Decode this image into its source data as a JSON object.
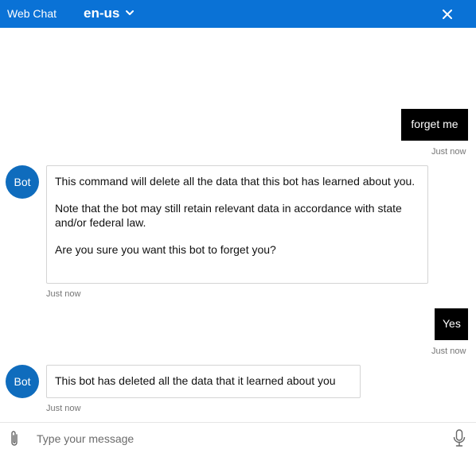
{
  "header": {
    "title": "Web Chat",
    "locale": "en-us",
    "bg_color": "#0a72d6"
  },
  "messages": [
    {
      "from": "user",
      "text": "forget me",
      "timestamp": "Just now"
    },
    {
      "from": "bot",
      "avatar_initials": "Bot",
      "paragraphs": [
        "This command will delete all the data that this bot has learned about you.",
        "Note that the bot may still retain relevant data in accordance with state and/or federal law.",
        "Are you sure you want this bot to forget you?"
      ],
      "timestamp": "Just now"
    },
    {
      "from": "user",
      "text": "Yes",
      "timestamp": "Just now"
    },
    {
      "from": "bot",
      "avatar_initials": "Bot",
      "paragraphs": [
        "This bot has deleted all the data that it learned about you"
      ],
      "timestamp": "Just now"
    }
  ],
  "composer": {
    "placeholder": "Type your message",
    "value": ""
  },
  "icons": {
    "locale_dropdown": "chevron-down-icon",
    "close": "close-icon",
    "attach": "paperclip-icon",
    "microphone": "microphone-icon"
  },
  "colors": {
    "accent": "#0a72d6",
    "avatar": "#0f6cbd",
    "user_bubble": "#000000",
    "timestamp": "#767676"
  }
}
